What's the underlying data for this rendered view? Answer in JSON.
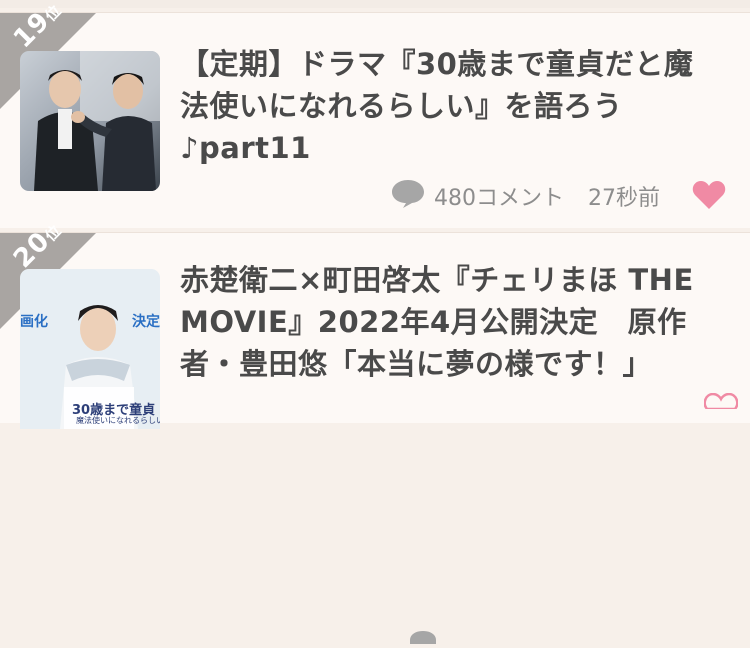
{
  "items": [
    {
      "rank": "19",
      "rank_suffix": "位",
      "title": "【定期】ドラマ『30歳まで童貞だと魔法使いになれるらしい』を語ろう♪part11",
      "comment_count": "480コメント",
      "time_ago": "27秒前"
    },
    {
      "rank": "20",
      "rank_suffix": "位",
      "title": "赤楚衛二×町田啓太『チェリまほ THE MOVIE』2022年4月公開決定　原作者・豊田悠「本当に夢の様です！」",
      "thumb_text_left": "画化",
      "thumb_text_right": "決定",
      "thumb_poster_text": "30歳まで童貞",
      "thumb_poster_sub": "魔法使いになれるらしい"
    }
  ],
  "colors": {
    "rank_badge": "#a9a5a2",
    "heart": "#f08aa4",
    "text": "#4a4a4a",
    "meta": "#8d8d8d"
  },
  "icons": [
    "comment-bubble-icon",
    "heart-icon"
  ]
}
